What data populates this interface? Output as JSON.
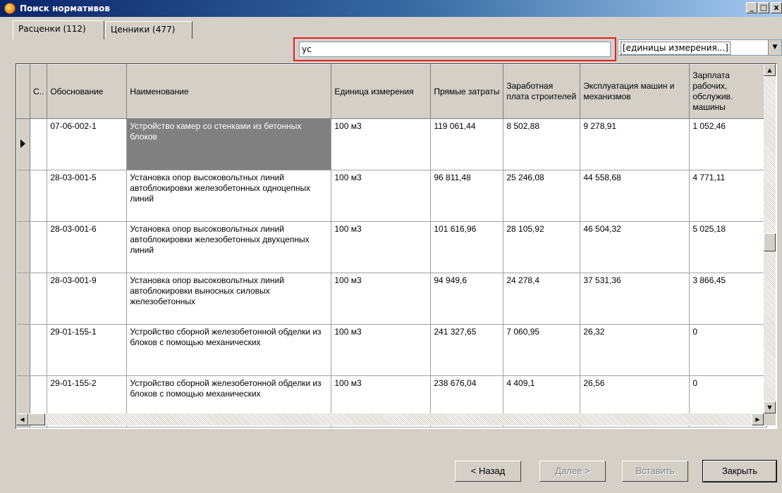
{
  "window": {
    "title": "Поиск нормативов"
  },
  "tabs": [
    {
      "label": "Расценки (112)"
    },
    {
      "label": "Ценники (477)"
    }
  ],
  "search": {
    "value": "ус"
  },
  "units_filter": {
    "value": "[единицы измерения...]"
  },
  "table": {
    "headers": [
      "С..",
      "Обоснование",
      "Наименование",
      "Единица измерения",
      "Прямые затраты",
      "Заработная плата строителей",
      "Эксплуатация машин и механизмов",
      "Зарплата рабочих, обслужив. машины"
    ],
    "rows": [
      {
        "code": "07-06-002-1",
        "name": "Устройство камер со стенками из бетонных блоков",
        "unit": "100 м3",
        "direct": "119 061,44",
        "wages": "8 502,88",
        "machines": "9 278,91",
        "mach_wages": "1 052,46"
      },
      {
        "code": "28-03-001-5",
        "name": "Установка опор высоковольтных линий автоблокировки железобетонных одноцепных линий",
        "unit": "100 м3",
        "direct": "96 811,48",
        "wages": "25 246,08",
        "machines": "44 558,68",
        "mach_wages": "4 771,11"
      },
      {
        "code": "28-03-001-6",
        "name": "Установка опор высоковольтных линий автоблокировки железобетонных двухцепных линий",
        "unit": "100 м3",
        "direct": "101 616,96",
        "wages": "28 105,92",
        "machines": "46 504,32",
        "mach_wages": "5 025,18"
      },
      {
        "code": "28-03-001-9",
        "name": "Установка опор высоковольтных линий автоблокировки выносных силовых железобетонных",
        "unit": "100 м3",
        "direct": "94 949,6",
        "wages": "24 278,4",
        "machines": "37 531,36",
        "mach_wages": "3 866,45"
      },
      {
        "code": "29-01-155-1",
        "name": "Устройство сборной железобетонной обделки из блоков с помощью механических",
        "unit": "100 м3",
        "direct": "241 327,65",
        "wages": "7 060,95",
        "machines": "26,32",
        "mach_wages": "0"
      },
      {
        "code": "29-01-155-2",
        "name": "Устройство сборной железобетонной обделки из блоков с помощью механических",
        "unit": "100 м3",
        "direct": "238 676,04",
        "wages": "4 409,1",
        "machines": "26,56",
        "mach_wages": "0"
      }
    ]
  },
  "buttons": {
    "back": "< Назад",
    "next": "Далее >",
    "insert": "Вставить",
    "close": "Закрыть"
  },
  "window_controls": {
    "minimize": "_",
    "maximize": "□",
    "close": "x"
  },
  "icons": {
    "app": "app-logo-icon",
    "row_pointer": "row-pointer-icon"
  },
  "colors": {
    "titlebar": "#0a246a",
    "selection": "#808080",
    "search_highlight": "#e02020",
    "face": "#d4d0c8"
  }
}
